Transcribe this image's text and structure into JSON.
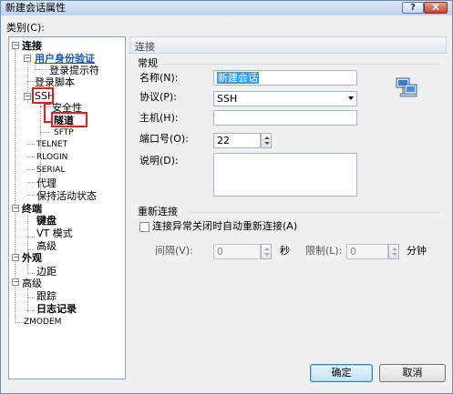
{
  "window": {
    "title": "新建会话属性",
    "help_glyph": "?",
    "close_glyph": "X"
  },
  "category_label": "类别(C):",
  "tree": {
    "items": [
      {
        "label": "连接",
        "expander": "−"
      },
      {
        "label": "用户身份验证",
        "expander": "−"
      },
      {
        "label": "登录提示符"
      },
      {
        "label": "登录脚本"
      },
      {
        "label": "SSH",
        "expander": "−"
      },
      {
        "label": "安全性"
      },
      {
        "label": "隧道"
      },
      {
        "label": "SFTP"
      },
      {
        "label": "TELNET"
      },
      {
        "label": "RLOGIN"
      },
      {
        "label": "SERIAL"
      },
      {
        "label": "代理"
      },
      {
        "label": "保持活动状态"
      },
      {
        "label": "终端",
        "expander": "−"
      },
      {
        "label": "键盘"
      },
      {
        "label": "VT 模式"
      },
      {
        "label": "高级"
      },
      {
        "label": "外观",
        "expander": "−"
      },
      {
        "label": "边距"
      },
      {
        "label": "高级",
        "expander": "−"
      },
      {
        "label": "跟踪"
      },
      {
        "label": "日志记录"
      },
      {
        "label": "ZMODEM"
      }
    ]
  },
  "section_title": "连接",
  "general": {
    "group_title": "常规",
    "name_label": "名称(N):",
    "name_value": "新建会话",
    "protocol_label": "协议(P):",
    "protocol_value": "SSH",
    "host_label": "主机(H):",
    "host_value": "",
    "port_label": "端口号(O):",
    "port_value": "22",
    "desc_label": "说明(D):",
    "desc_value": ""
  },
  "reconnect": {
    "group_title": "重新连接",
    "checkbox_label": "连接异常关闭时自动重新连接(A)",
    "interval_label": "间隔(V):",
    "interval_value": "0",
    "interval_unit": "秒",
    "limit_label": "限制(L):",
    "limit_value": "0",
    "limit_unit": "分钟"
  },
  "buttons": {
    "ok": "确定",
    "cancel": "取消"
  }
}
